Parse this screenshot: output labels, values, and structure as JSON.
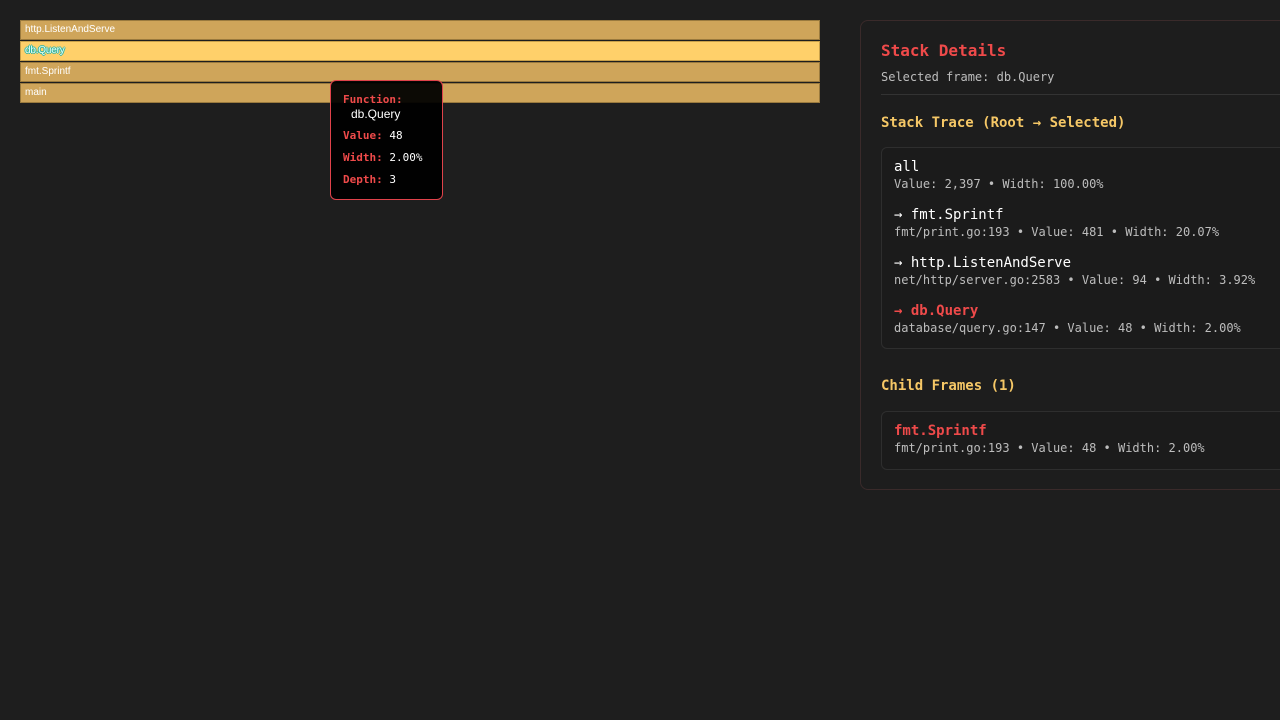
{
  "flamegraph": {
    "frames": [
      {
        "label": "http.ListenAndServe"
      },
      {
        "label": "db.Query"
      },
      {
        "label": "fmt.Sprintf"
      },
      {
        "label": "main"
      }
    ]
  },
  "tooltip": {
    "function_key": "Function:",
    "function_value": "db.Query",
    "value_key": "Value:",
    "value_value": "48",
    "width_key": "Width:",
    "width_value": "2.00%",
    "depth_key": "Depth:",
    "depth_value": "3"
  },
  "panel": {
    "title": "Stack Details",
    "selected_label": "Selected frame: db.Query",
    "stack_trace_title": "Stack Trace (Root → Selected)",
    "stack": [
      {
        "name": "all",
        "meta": "Value: 2,397 • Width: 100.00%"
      },
      {
        "name": "→ fmt.Sprintf",
        "meta": "fmt/print.go:193 • Value: 481 • Width: 20.07%"
      },
      {
        "name": "→ http.ListenAndServe",
        "meta": "net/http/server.go:2583 • Value: 94 • Width: 3.92%"
      },
      {
        "name": "→ db.Query",
        "meta": "database/query.go:147 • Value: 48 • Width: 2.00%"
      }
    ],
    "child_frames_title": "Child Frames (1)",
    "children": [
      {
        "name": "fmt.Sprintf",
        "meta": "fmt/print.go:193 • Value: 48 • Width: 2.00%"
      }
    ]
  },
  "colors": {
    "frame": "#cfa55a",
    "frame_selected": "#ffd06a",
    "accent_red": "#ef4a4a",
    "accent_yellow": "#f5c766"
  }
}
